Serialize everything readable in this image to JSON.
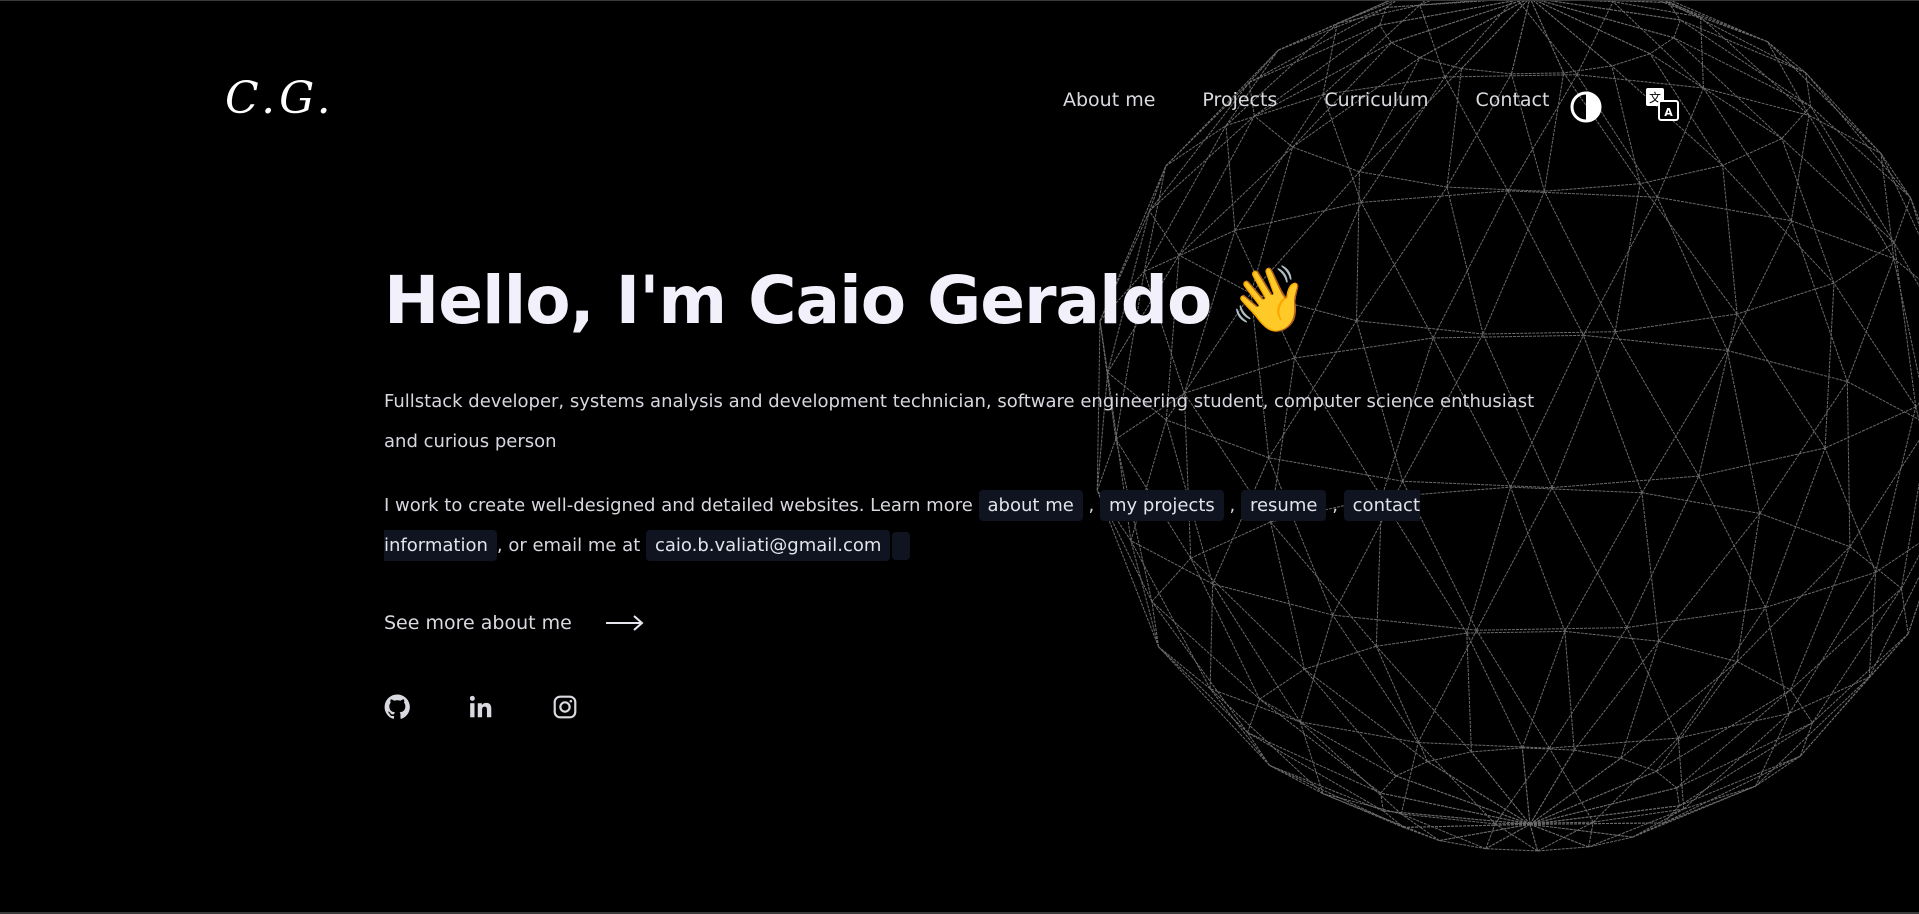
{
  "logo": {
    "text": "C.G."
  },
  "nav": {
    "items": [
      {
        "label": "About me"
      },
      {
        "label": "Projects"
      },
      {
        "label": "Curriculum"
      },
      {
        "label": "Contact"
      }
    ]
  },
  "icons": {
    "theme": "contrast-half-circle-icon",
    "language": "translate-icon",
    "arrow": "arrow-right-icon",
    "socials": [
      "github-icon",
      "linkedin-icon",
      "instagram-icon"
    ],
    "wave": "waving-hand-emoji"
  },
  "hero": {
    "title": "Hello, I'm Caio Geraldo",
    "wave_emoji": "👋",
    "description": "Fullstack developer, systems analysis and development technician, software engineering student, computer science enthusiast and curious person",
    "intro_text": "I work to create well-designed and detailed websites. Learn more",
    "link_about": "about me",
    "link_projects": "my projects",
    "link_resume": "resume",
    "link_contact": "contact information",
    "comma": ",",
    "or_text": ", or",
    "email_prefix": "email me at",
    "email": "caio.b.valiati@gmail.com",
    "see_more": "See more about me"
  },
  "colors": {
    "background": "#000000",
    "title": "#f1f0fb",
    "chip_bg": "#0f1420",
    "sphere_lines": "#6b6b6b"
  }
}
